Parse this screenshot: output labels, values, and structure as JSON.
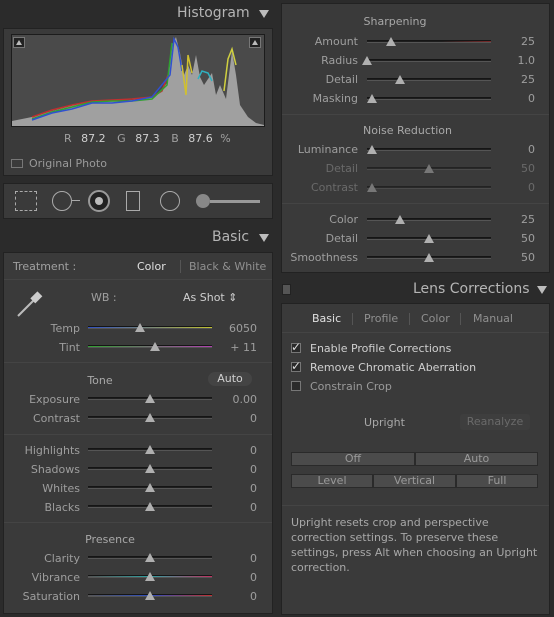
{
  "histogram": {
    "title": "Histogram",
    "r_label": "R",
    "r_value": "87.2",
    "g_label": "G",
    "g_value": "87.3",
    "b_label": "B",
    "b_value": "87.6",
    "pct": "%",
    "original_photo": "Original Photo"
  },
  "basic": {
    "title": "Basic",
    "treatment_label": "Treatment :",
    "treatment_color": "Color",
    "treatment_bw": "Black & White",
    "wb_label": "WB :",
    "wb_value": "As Shot ⇕",
    "temp_label": "Temp",
    "temp_value": "6050",
    "tint_label": "Tint",
    "tint_value": "+ 11",
    "tone_label": "Tone",
    "auto_label": "Auto",
    "exposure_label": "Exposure",
    "exposure_value": "0.00",
    "contrast_label": "Contrast",
    "contrast_value": "0",
    "highlights_label": "Highlights",
    "highlights_value": "0",
    "shadows_label": "Shadows",
    "shadows_value": "0",
    "whites_label": "Whites",
    "whites_value": "0",
    "blacks_label": "Blacks",
    "blacks_value": "0",
    "presence_label": "Presence",
    "clarity_label": "Clarity",
    "clarity_value": "0",
    "vibrance_label": "Vibrance",
    "vibrance_value": "0",
    "saturation_label": "Saturation",
    "saturation_value": "0"
  },
  "detail": {
    "sharpening_label": "Sharpening",
    "amount_label": "Amount",
    "amount_value": "25",
    "radius_label": "Radius",
    "radius_value": "1.0",
    "detail_label": "Detail",
    "detail_value": "25",
    "masking_label": "Masking",
    "masking_value": "0",
    "noise_label": "Noise Reduction",
    "luminance_label": "Luminance",
    "luminance_value": "0",
    "ldetail_label": "Detail",
    "ldetail_value": "50",
    "lcontrast_label": "Contrast",
    "lcontrast_value": "0",
    "color_label": "Color",
    "color_value": "25",
    "cdetail_label": "Detail",
    "cdetail_value": "50",
    "smoothness_label": "Smoothness",
    "smoothness_value": "50"
  },
  "lens": {
    "title": "Lens Corrections",
    "tabs": [
      "Basic",
      "Profile",
      "Color",
      "Manual"
    ],
    "enable_profile": "Enable Profile Corrections",
    "remove_ca": "Remove Chromatic Aberration",
    "constrain_crop": "Constrain Crop",
    "upright_label": "Upright",
    "reanalyze": "Reanalyze",
    "off": "Off",
    "auto": "Auto",
    "level": "Level",
    "vertical": "Vertical",
    "full": "Full",
    "info": "Upright resets crop and perspective correction settings. To preserve these settings, press Alt when choosing an Upright correction."
  },
  "colors": {
    "panel_bg": "#3a3a3a",
    "app_bg": "#2b2b2b",
    "text": "#a8a8a8"
  }
}
